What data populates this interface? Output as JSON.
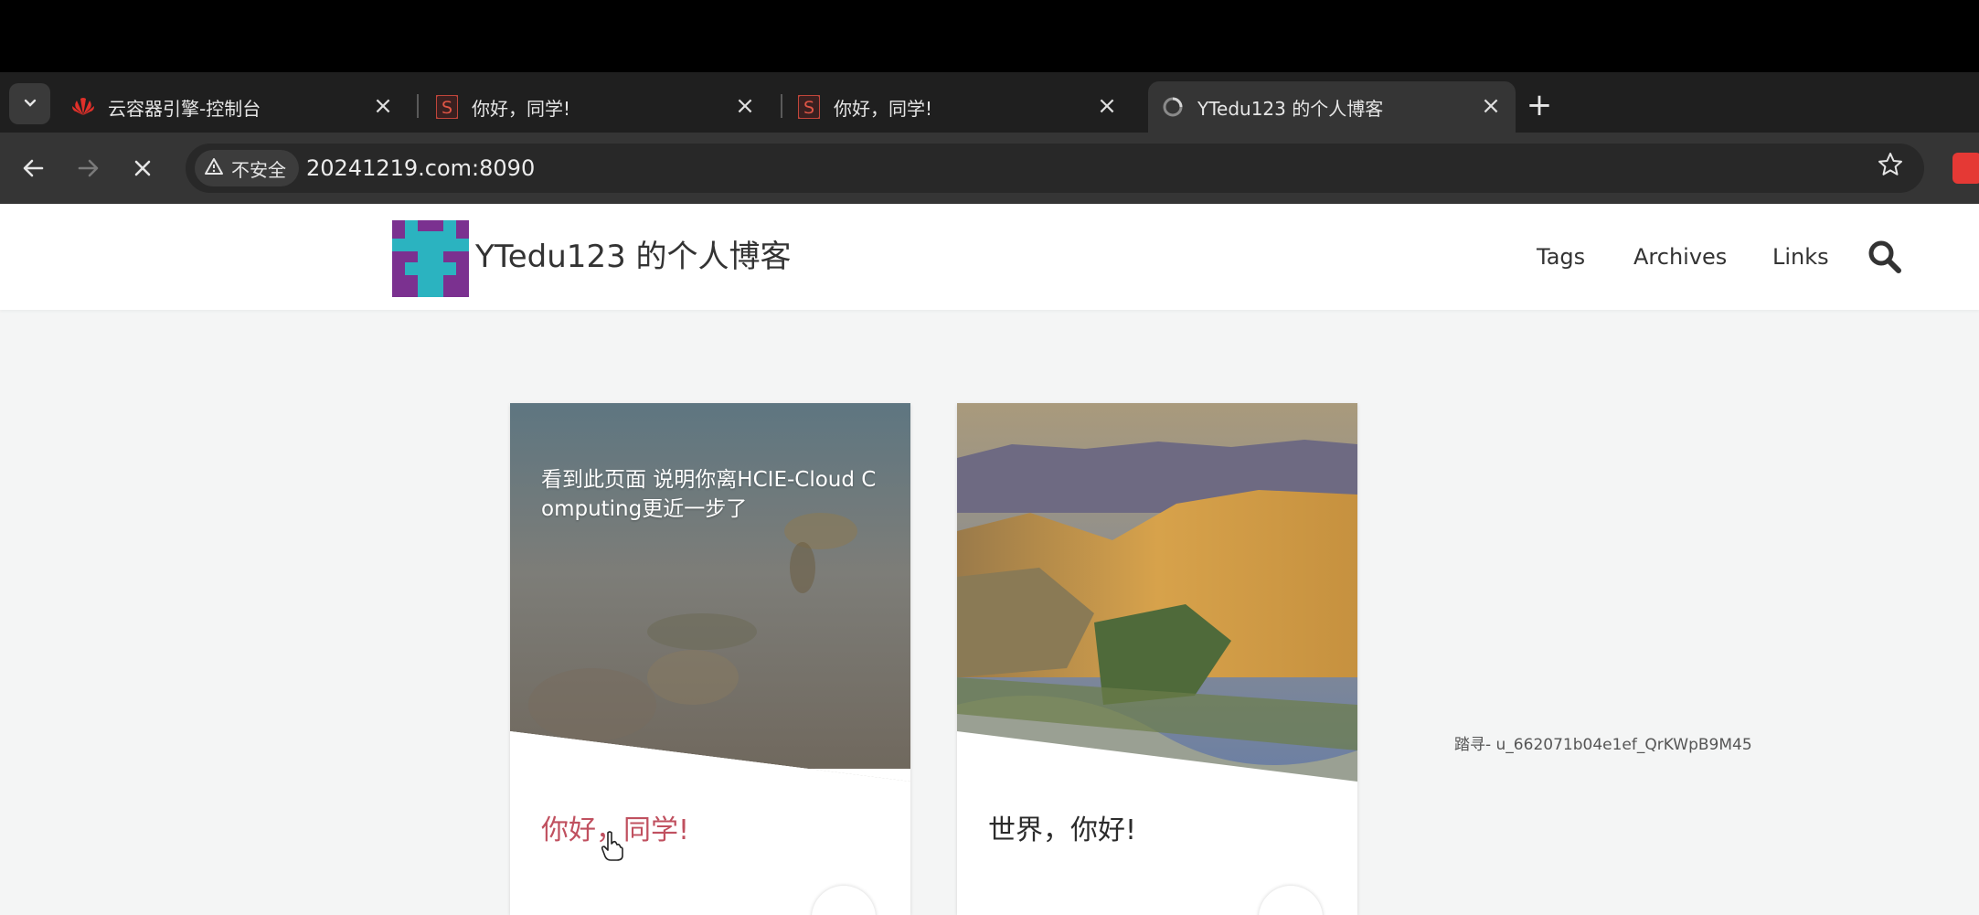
{
  "browser": {
    "tabs": [
      {
        "title": "云容器引擎-控制台",
        "favicon": "huawei-icon",
        "active": false
      },
      {
        "title": "你好，同学!",
        "favicon": "s-icon",
        "active": false
      },
      {
        "title": "你好，同学!",
        "favicon": "s-icon",
        "active": false
      },
      {
        "title": "YTedu123 的个人博客",
        "favicon": "loading-icon",
        "active": true
      }
    ],
    "security_label": "不安全",
    "url": "20241219.com:8090"
  },
  "site": {
    "title": "YTedu123 的个人博客",
    "nav": [
      "Tags",
      "Archives",
      "Links"
    ]
  },
  "posts": [
    {
      "excerpt": "看到此页面 说明你离HCIE-Cloud Computing更近一步了",
      "title": "你好，同学!",
      "title_color": "#c0505f"
    },
    {
      "excerpt": "",
      "title": "世界，你好!",
      "title_color": "#2b2b2b"
    }
  ],
  "watermark": "踏寻- u_662071b04e1ef_QrKWpB9M45",
  "colors": {
    "tab_strip": "#1f1f1f",
    "toolbar": "#353535",
    "accent_pink": "#c0505f",
    "logo_teal": "#2bb3c0",
    "logo_purple": "#7b3190"
  }
}
